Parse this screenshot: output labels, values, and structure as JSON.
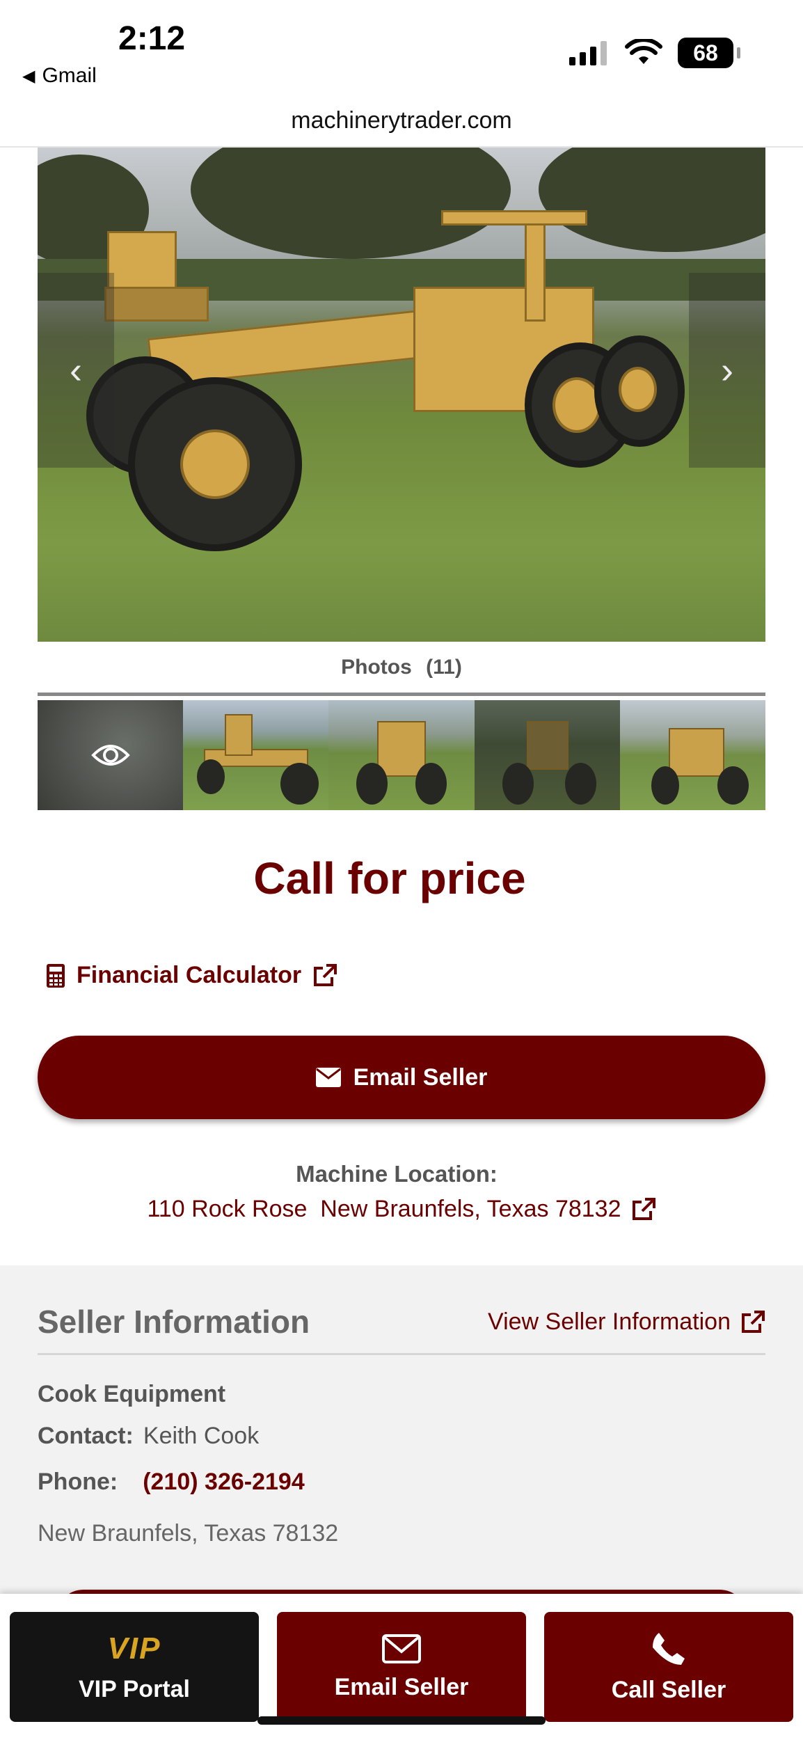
{
  "status_bar": {
    "time": "2:12",
    "back_app": "Gmail",
    "battery": "68"
  },
  "browser": {
    "url": "machinerytrader.com"
  },
  "gallery": {
    "photos_label": "Photos",
    "photos_count": "(11)"
  },
  "listing": {
    "price": "Call for price",
    "financial_calculator": "Financial Calculator",
    "email_seller": "Email Seller",
    "machine_location_label": "Machine Location:",
    "machine_location": "110 Rock Rose  New Braunfels, Texas 78132"
  },
  "seller": {
    "section_title": "Seller Information",
    "view_link": "View Seller Information",
    "name": "Cook Equipment",
    "contact_label": "Contact:",
    "contact_value": "Keith Cook",
    "phone_label": "Phone:",
    "phone_value": "(210) 326-2194",
    "city": "New Braunfels, Texas 78132"
  },
  "bottom_bar": {
    "vip_logo": "VIP",
    "vip_label": "VIP Portal",
    "email_label": "Email Seller",
    "call_label": "Call Seller"
  },
  "colors": {
    "brand": "#6b0000",
    "vip_gold": "#d9a521"
  }
}
